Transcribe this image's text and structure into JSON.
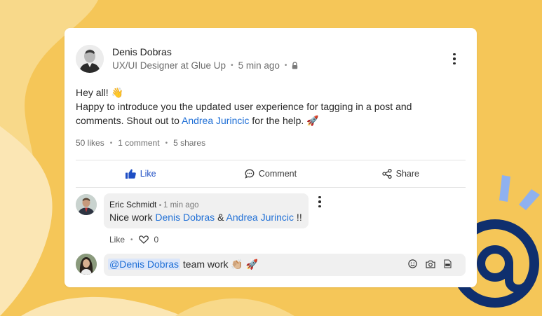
{
  "colors": {
    "background": "#F5C658",
    "accent_blue": "#1f6fd6",
    "like_blue": "#1f4fc4",
    "at_navy": "#0f2f6e",
    "ray_blue": "#8fb1ef"
  },
  "post": {
    "author_name": "Denis Dobras",
    "author_title": "UX/UI Designer at Glue Up",
    "time": "5 min ago",
    "visibility_icon": "lock-icon",
    "greeting": "Hey all! 👋",
    "body_before": "Happy to introduce you the updated user experience for tagging in a post and comments. Shout out to ",
    "body_mention": "Andrea Jurincic",
    "body_after": " for the help. 🚀",
    "stats": {
      "likes": "50 likes",
      "comments": "1 comment",
      "shares": "5 shares"
    },
    "actions": {
      "like": "Like",
      "comment": "Comment",
      "share": "Share"
    }
  },
  "comment": {
    "author": "Eric Schmidt",
    "time": "1 min ago",
    "text_before": "Nice work ",
    "mention_1": "Denis Dobras",
    "text_mid": " & ",
    "mention_2": "Andrea Jurincic",
    "text_after": " !!",
    "like_label": "Like",
    "like_count": "0"
  },
  "reply": {
    "mention": "@Denis Dobras",
    "text": " team work 👏🏼 🚀",
    "icons": [
      "emoji-icon",
      "camera-icon",
      "gif-icon"
    ]
  }
}
